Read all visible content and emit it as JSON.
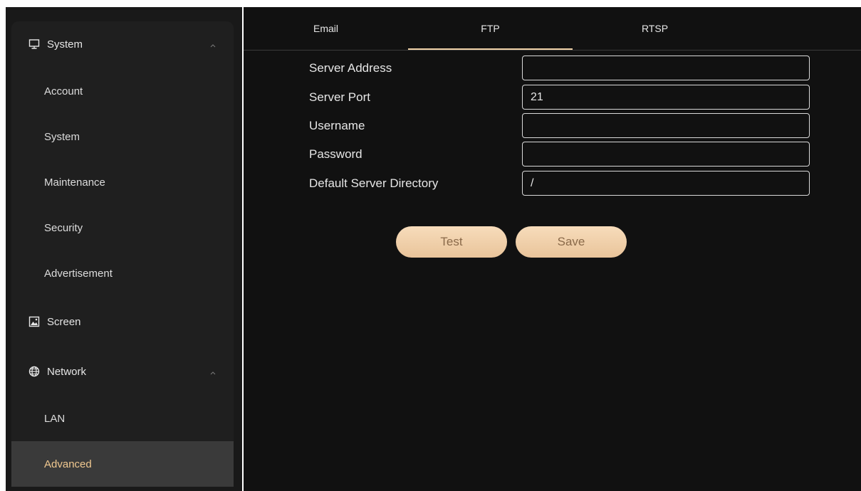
{
  "sidebar": {
    "groups": [
      {
        "label": "System",
        "icon": "monitor-icon"
      },
      {
        "label": "Screen",
        "icon": "image-icon"
      },
      {
        "label": "Network",
        "icon": "globe-icon"
      }
    ],
    "system_items": [
      "Account",
      "System",
      "Maintenance",
      "Security",
      "Advertisement"
    ],
    "network_items": [
      "LAN",
      "Advanced"
    ],
    "active_item": "Advanced"
  },
  "tabs": [
    {
      "label": "Email"
    },
    {
      "label": "FTP",
      "active": true
    },
    {
      "label": "RTSP"
    }
  ],
  "form": {
    "fields": [
      {
        "label": "Server Address",
        "value": ""
      },
      {
        "label": "Server Port",
        "value": "21"
      },
      {
        "label": "Username",
        "value": ""
      },
      {
        "label": "Password",
        "value": ""
      },
      {
        "label": "Default Server Directory",
        "value": "/"
      }
    ],
    "test_label": "Test",
    "save_label": "Save"
  },
  "colors": {
    "accent": "#f0c890",
    "button_bg": "#f1d2ab",
    "main_bg": "#111111",
    "sidebar_bg": "#1f1f1f"
  }
}
